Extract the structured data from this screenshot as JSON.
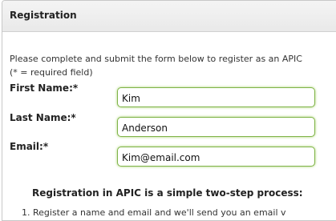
{
  "panel": {
    "title": "Registration"
  },
  "intro": {
    "line1": "Please complete and submit the form below to register as an APIC",
    "line2": "(* = required field)"
  },
  "fields": {
    "first_name": {
      "label": "First Name:*",
      "value": "Kim"
    },
    "last_name": {
      "label": "Last Name:*",
      "value": "Anderson"
    },
    "email": {
      "label": "Email:*",
      "value": "Kim@email.com"
    }
  },
  "process": {
    "heading": "Registration in APIC is a simple two-step process:",
    "step1": "1. Register a name and email and we'll send you an email v"
  },
  "colors": {
    "input_border": "#7fb348",
    "input_glow": "#a7d36d"
  }
}
